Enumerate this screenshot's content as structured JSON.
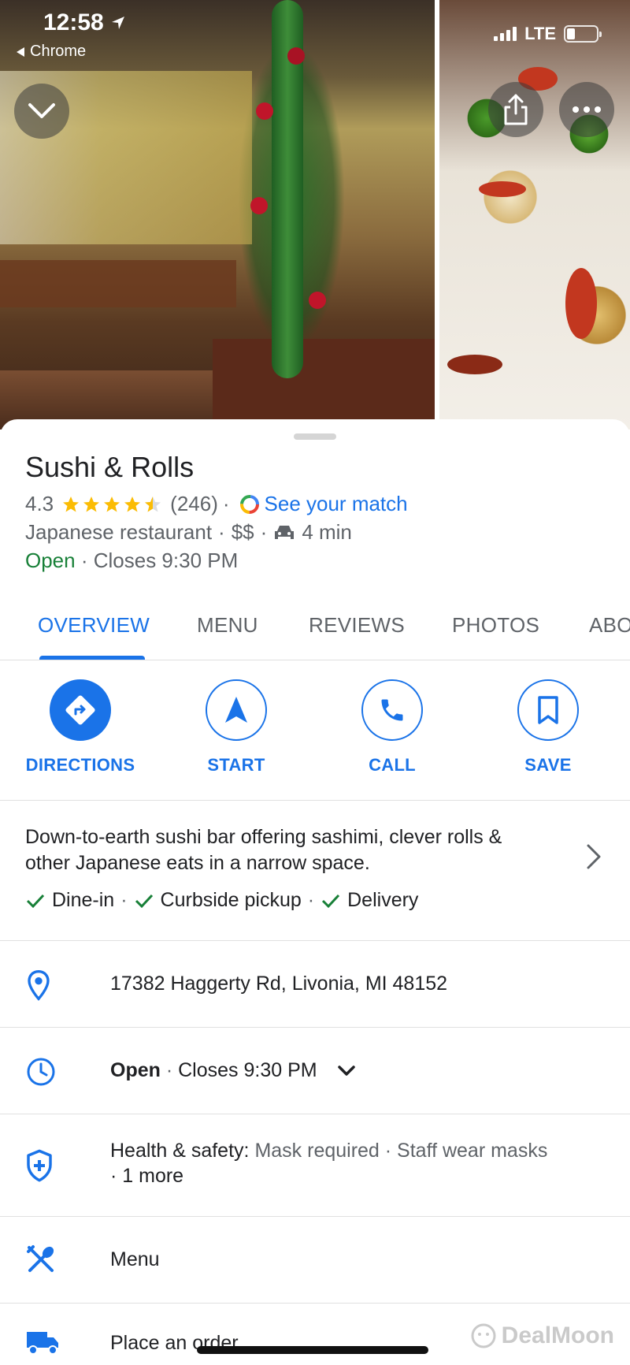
{
  "status_bar": {
    "time": "12:58",
    "back_app": "Chrome",
    "network": "LTE"
  },
  "place": {
    "name": "Sushi & Rolls",
    "rating": "4.3",
    "rating_value": 4.3,
    "review_count": "(246)",
    "match_link": "See your match",
    "category": "Japanese restaurant",
    "price": "$$",
    "drive_time": "4 min",
    "open_status": "Open",
    "closes": "Closes 9:30 PM"
  },
  "tabs": [
    {
      "label": "OVERVIEW",
      "active": true
    },
    {
      "label": "MENU",
      "active": false
    },
    {
      "label": "REVIEWS",
      "active": false
    },
    {
      "label": "PHOTOS",
      "active": false
    },
    {
      "label": "ABOUT",
      "active": false
    }
  ],
  "actions": [
    {
      "label": "DIRECTIONS",
      "icon": "directions-icon"
    },
    {
      "label": "START",
      "icon": "navigation-arrow-icon"
    },
    {
      "label": "CALL",
      "icon": "phone-icon"
    },
    {
      "label": "SAVE",
      "icon": "bookmark-icon"
    }
  ],
  "description": {
    "text": "Down-to-earth sushi bar offering sashimi, clever rolls & other Japanese eats in a narrow space.",
    "amenities": [
      "Dine-in",
      "Curbside pickup",
      "Delivery"
    ]
  },
  "details": {
    "address": "17382 Haggerty Rd, Livonia, MI 48152",
    "hours_open": "Open",
    "hours_closes": "Closes 9:30 PM",
    "health_label": "Health & safety:",
    "health_values": "Mask required · Staff wear masks",
    "health_more": "· 1 more",
    "menu": "Menu",
    "order": "Place an order"
  },
  "watermark": "DealMoon",
  "colors": {
    "accent": "#1a73e8",
    "open": "#188038",
    "star": "#fbbc04",
    "secondary_text": "#5f6368"
  }
}
